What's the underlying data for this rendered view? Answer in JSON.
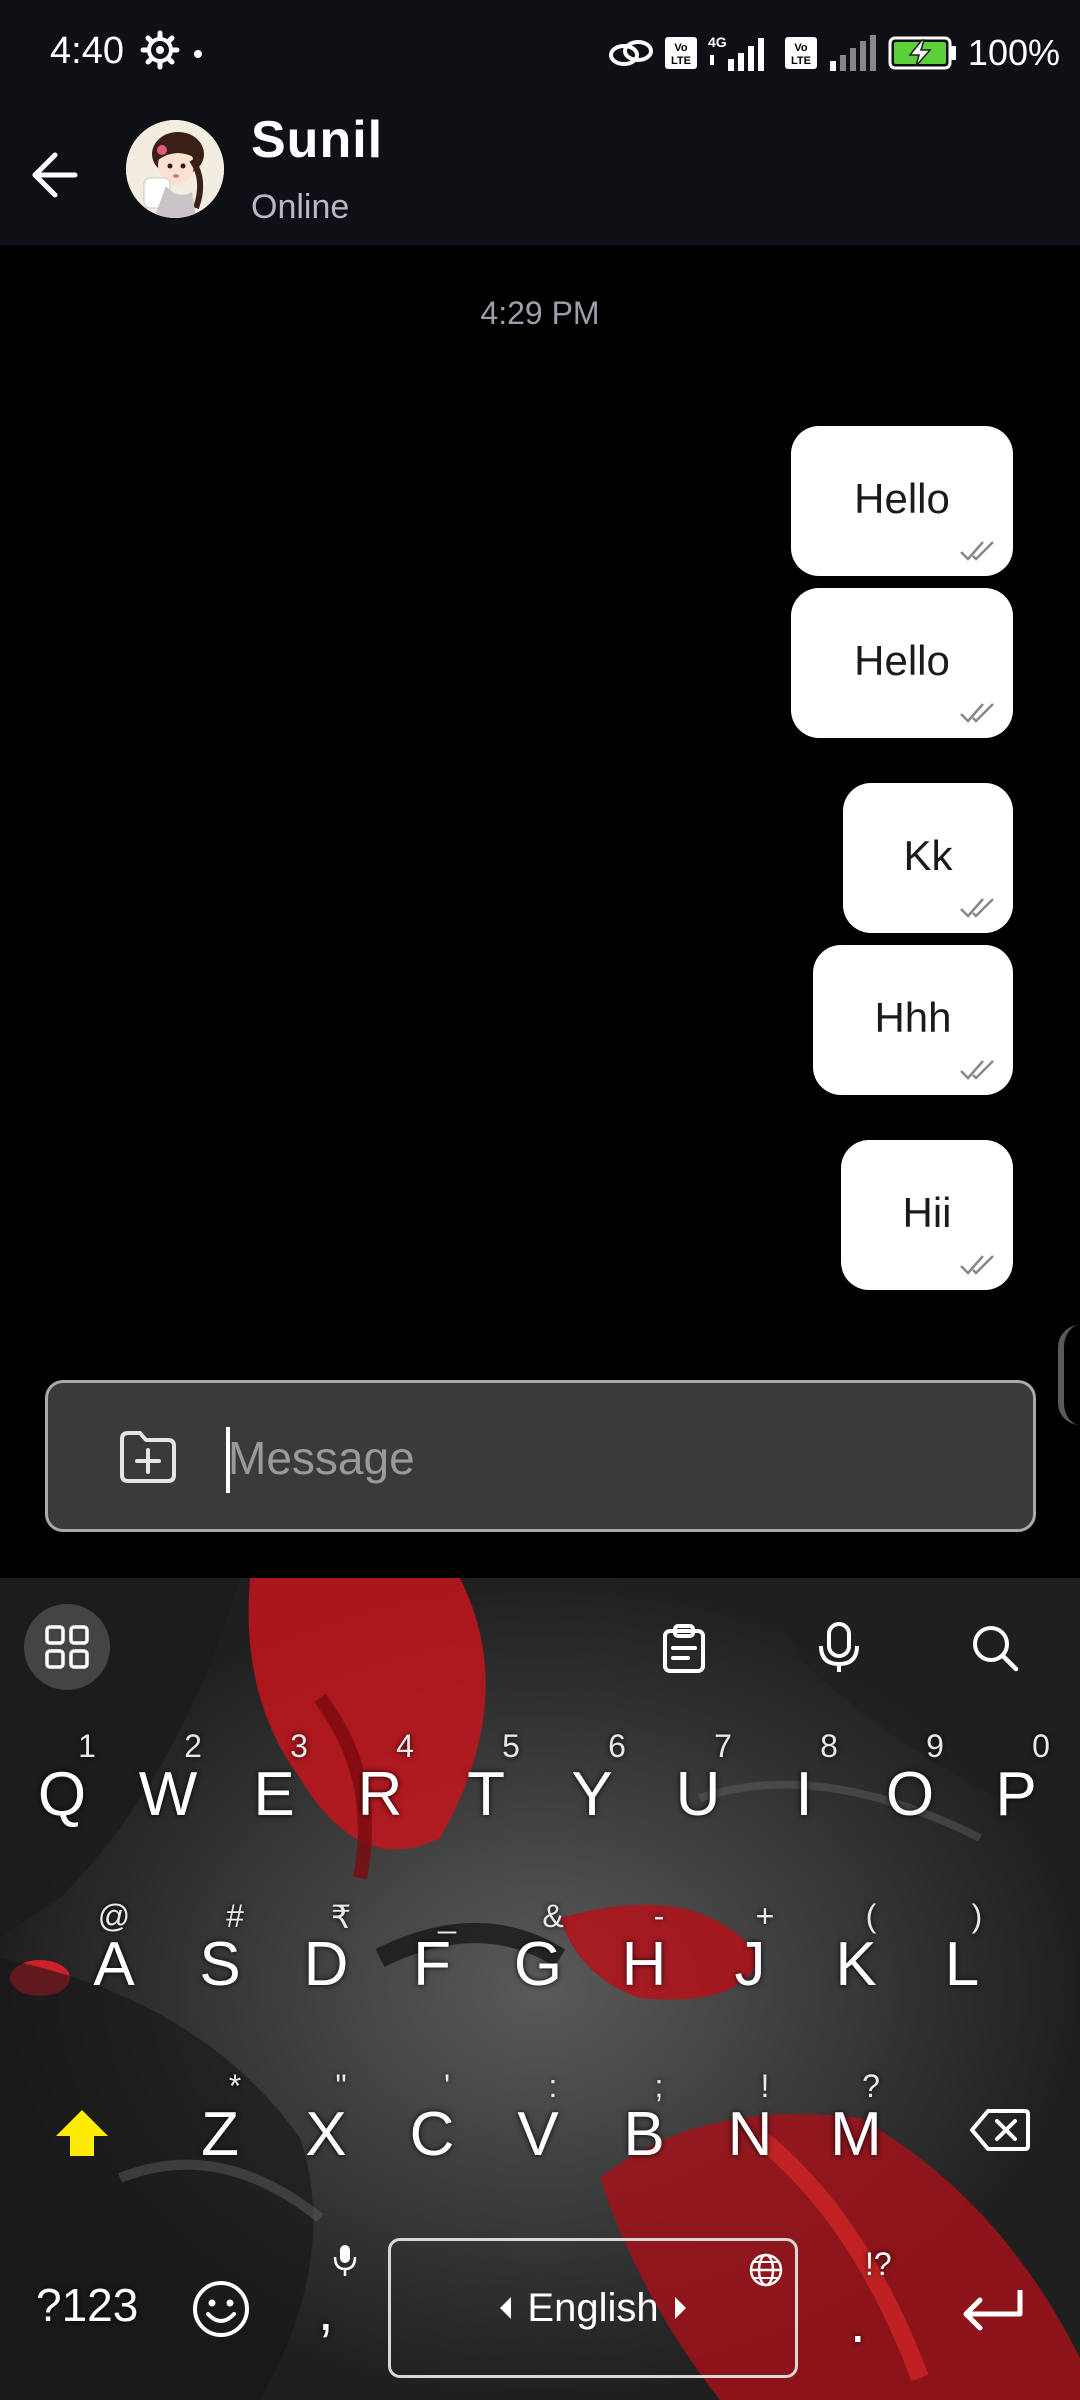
{
  "status_bar": {
    "time": "4:40",
    "battery": "100%"
  },
  "header": {
    "contact_name": "Sunil",
    "contact_status": "Online"
  },
  "chat": {
    "time_divider": "4:29 PM",
    "messages": [
      {
        "text": "Hello",
        "direction": "outgoing",
        "status": "read"
      },
      {
        "text": "Hello",
        "direction": "outgoing",
        "status": "read"
      },
      {
        "text": "Kk",
        "direction": "outgoing",
        "status": "read"
      },
      {
        "text": "Hhh",
        "direction": "outgoing",
        "status": "read"
      },
      {
        "text": "Hii",
        "direction": "outgoing",
        "status": "read"
      }
    ]
  },
  "composer": {
    "placeholder": "Message",
    "value": ""
  },
  "keyboard": {
    "row1": [
      {
        "key": "Q",
        "hint": "1"
      },
      {
        "key": "W",
        "hint": "2"
      },
      {
        "key": "E",
        "hint": "3"
      },
      {
        "key": "R",
        "hint": "4"
      },
      {
        "key": "T",
        "hint": "5"
      },
      {
        "key": "Y",
        "hint": "6"
      },
      {
        "key": "U",
        "hint": "7"
      },
      {
        "key": "I",
        "hint": "8"
      },
      {
        "key": "O",
        "hint": "9"
      },
      {
        "key": "P",
        "hint": "0"
      }
    ],
    "row2": [
      {
        "key": "A",
        "hint": "@"
      },
      {
        "key": "S",
        "hint": "#"
      },
      {
        "key": "D",
        "hint": "₹"
      },
      {
        "key": "F",
        "hint": "_"
      },
      {
        "key": "G",
        "hint": "&"
      },
      {
        "key": "H",
        "hint": "-"
      },
      {
        "key": "J",
        "hint": "+"
      },
      {
        "key": "K",
        "hint": "("
      },
      {
        "key": "L",
        "hint": ")"
      }
    ],
    "row3": [
      {
        "key": "Z",
        "hint": "*"
      },
      {
        "key": "X",
        "hint": "\""
      },
      {
        "key": "C",
        "hint": "'"
      },
      {
        "key": "V",
        "hint": ":"
      },
      {
        "key": "B",
        "hint": ";"
      },
      {
        "key": "N",
        "hint": "!"
      },
      {
        "key": "M",
        "hint": "?"
      }
    ],
    "symbols_key": "?123",
    "comma_key": ",",
    "period_key": ".",
    "period_hint": "!?",
    "language": "English"
  },
  "colors": {
    "header_bg": "#0f0f16",
    "bubble_bg": "#ffffff",
    "shift_active": "#ffeb00",
    "keyboard_accent": "#c8141a"
  }
}
